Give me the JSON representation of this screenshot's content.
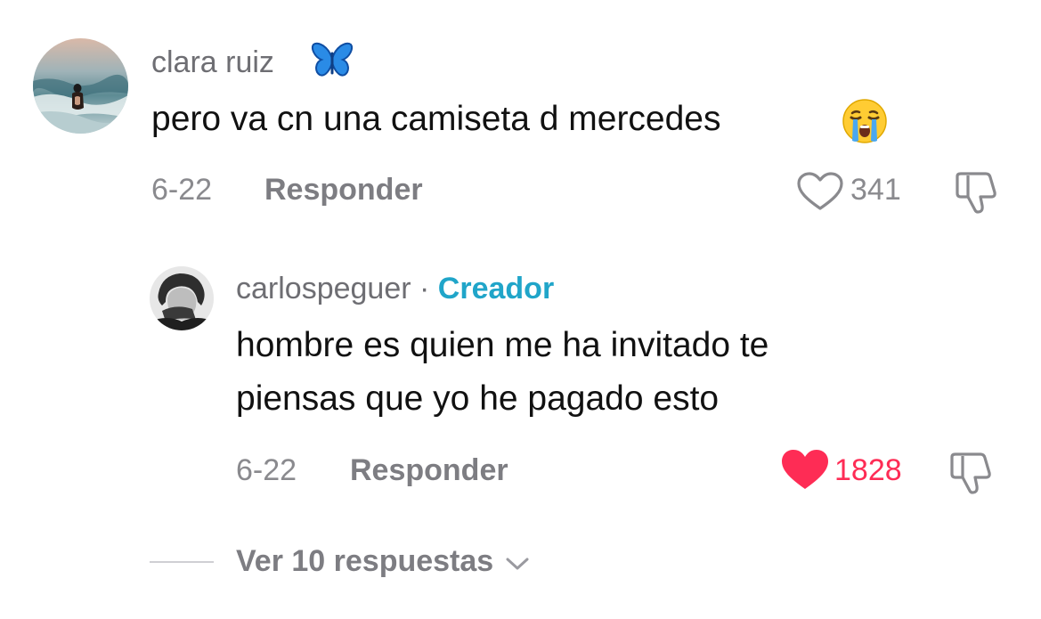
{
  "comments": [
    {
      "username": "clara ruiz",
      "username_emoji_icon": "butterfly-icon",
      "text": "pero va cn una camiseta d mercedes",
      "text_emoji_icon": "crying-face-icon",
      "date": "6-22",
      "reply_label": "Responder",
      "likes": "341",
      "liked": false
    },
    {
      "username": "carlospeguer",
      "separator": "·",
      "badge": "Creador",
      "text_lines": [
        "hombre es quien me ha invitado te",
        "piensas que yo he pagado esto"
      ],
      "date": "6-22",
      "reply_label": "Responder",
      "likes": "1828",
      "liked": true
    }
  ],
  "view_replies_label": "Ver 10 respuestas",
  "colors": {
    "liked_red": "#fe2c55",
    "creator_blue": "#20a5c9",
    "muted_gray": "#8a8a8e"
  }
}
